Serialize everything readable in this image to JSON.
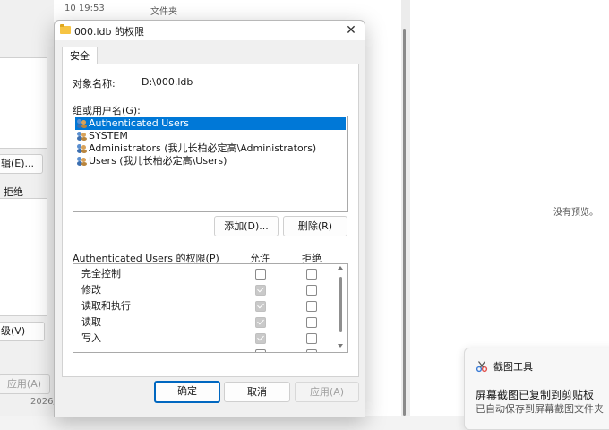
{
  "background_window": {
    "edit_btn": "辑(E)...",
    "deny_hdr": "拒绝",
    "advanced_btn": "级(V)",
    "apply_btn": "应用(A)"
  },
  "explorer": {
    "date_col": "10 19:53",
    "type_col": "文件夹",
    "date_bottom": "2026/",
    "preview_text": "没有预览。"
  },
  "dialog": {
    "title": "000.ldb 的权限",
    "tab": "安全",
    "object_label": "对象名称:",
    "object_value": "D:\\000.ldb",
    "group_label": "组或用户名(G):",
    "users": [
      {
        "label": "Authenticated Users",
        "selected": true
      },
      {
        "label": "SYSTEM"
      },
      {
        "label": "Administrators (我儿长柏必定高\\Administrators)"
      },
      {
        "label": "Users (我儿长柏必定高\\Users)"
      }
    ],
    "add_btn": "添加(D)...",
    "remove_btn": "删除(R)",
    "perm_label": "Authenticated Users 的权限(P)",
    "allow_hdr": "允许",
    "deny_hdr": "拒绝",
    "permissions": [
      {
        "name": "完全控制",
        "allow": false,
        "deny": false
      },
      {
        "name": "修改",
        "allow": true,
        "deny": false
      },
      {
        "name": "读取和执行",
        "allow": true,
        "deny": false
      },
      {
        "name": "读取",
        "allow": true,
        "deny": false
      },
      {
        "name": "写入",
        "allow": true,
        "deny": false
      }
    ],
    "ok_btn": "确定",
    "cancel_btn": "取消",
    "apply_btn": "应用(A)"
  },
  "toast": {
    "app_name": "截图工具",
    "title": "屏幕截图已复制到剪贴板",
    "body": "已自动保存到屏幕截图文件夹"
  }
}
